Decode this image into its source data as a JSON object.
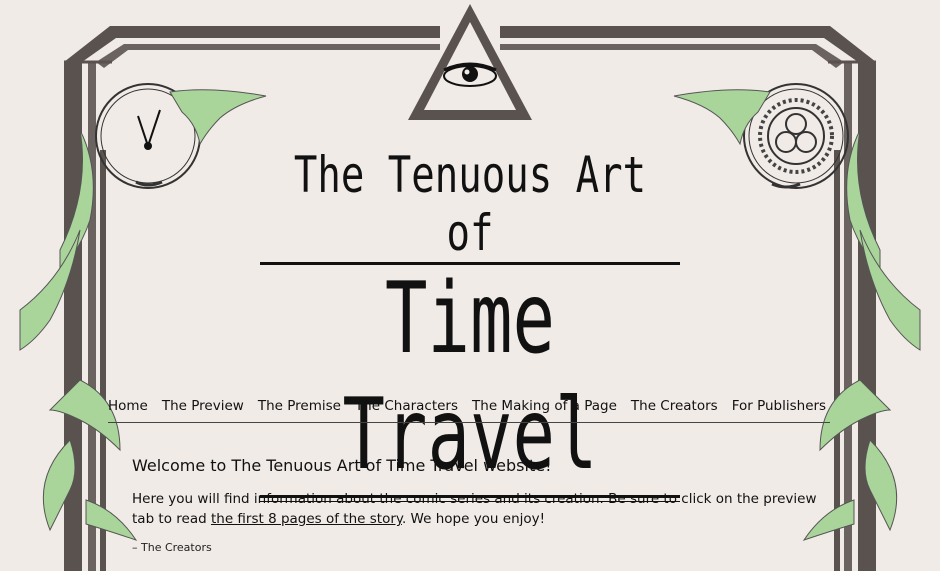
{
  "site": {
    "title_line1": "The Tenuous Art of",
    "title_line2": "Time Travel"
  },
  "nav": {
    "items": [
      {
        "label": "Home"
      },
      {
        "label": "The Preview"
      },
      {
        "label": "The Premise"
      },
      {
        "label": "The Characters"
      },
      {
        "label": "The Making of a Page"
      },
      {
        "label": "The Creators"
      },
      {
        "label": "For Publishers"
      }
    ]
  },
  "content": {
    "welcome": "Welcome to The Tenuous Art of Time Travel website!",
    "desc_before": "Here you will find information about the comic series and its creation. Be sure to click on the preview tab to read ",
    "desc_link": "the first 8 pages of the story",
    "desc_after": ". We hope you enjoy!",
    "signature": "– The Creators"
  },
  "colors": {
    "paper": "#f1ebe7",
    "frame": "#5a524f",
    "vine": "#a9d49a",
    "ink": "#111111"
  },
  "icons": [
    "eye-triangle-icon",
    "clock-icon",
    "gear-circle-icon",
    "vine-ornament"
  ]
}
